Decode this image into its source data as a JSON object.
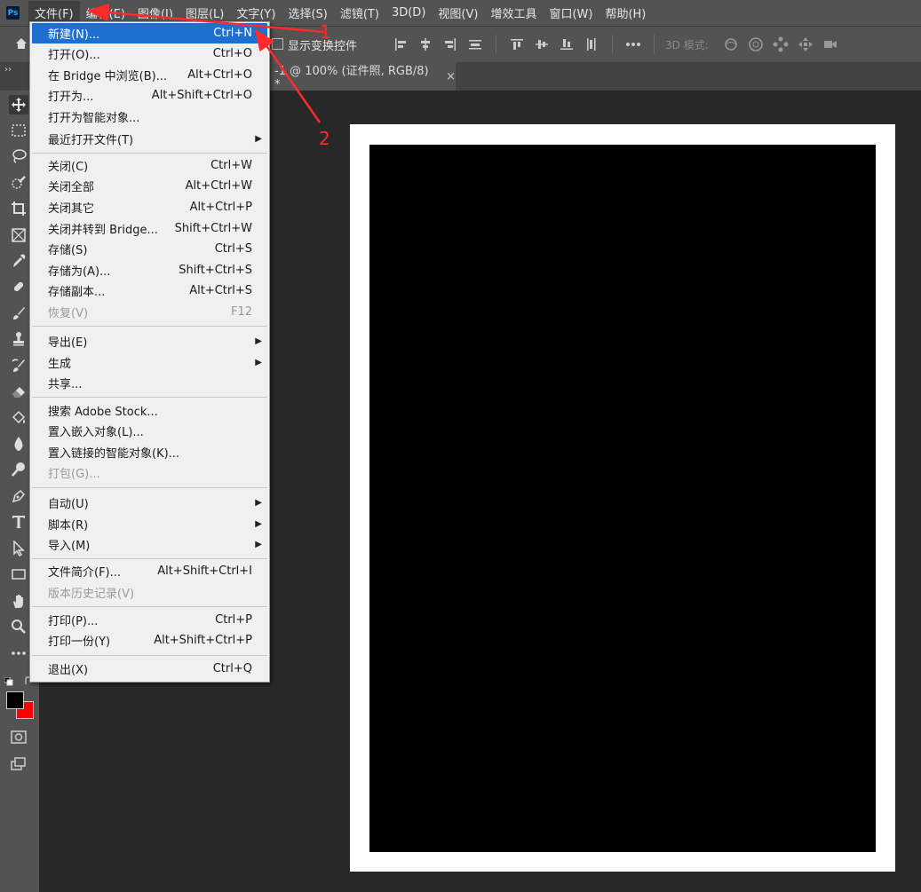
{
  "app": {
    "logo": "Ps"
  },
  "menubar": {
    "items": [
      "文件(F)",
      "编辑(E)",
      "图像(I)",
      "图层(L)",
      "文字(Y)",
      "选择(S)",
      "滤镜(T)",
      "3D(D)",
      "视图(V)",
      "增效工具",
      "窗口(W)",
      "帮助(H)"
    ]
  },
  "options": {
    "show_transform": "显示变换控件",
    "mode_3d": "3D 模式:"
  },
  "document_tab": {
    "title": "-1 @ 100% (证件照, RGB/8) *",
    "close": "×"
  },
  "file_menu": {
    "items": [
      {
        "label": "新建(N)...",
        "shortcut": "Ctrl+N",
        "highlight": true
      },
      {
        "label": "打开(O)...",
        "shortcut": "Ctrl+O"
      },
      {
        "label": "在 Bridge 中浏览(B)...",
        "shortcut": "Alt+Ctrl+O"
      },
      {
        "label": "打开为...",
        "shortcut": "Alt+Shift+Ctrl+O"
      },
      {
        "label": "打开为智能对象...",
        "shortcut": ""
      },
      {
        "label": "最近打开文件(T)",
        "shortcut": "",
        "submenu": true
      },
      {
        "label": "关闭(C)",
        "shortcut": "Ctrl+W"
      },
      {
        "label": "关闭全部",
        "shortcut": "Alt+Ctrl+W"
      },
      {
        "label": "关闭其它",
        "shortcut": "Alt+Ctrl+P"
      },
      {
        "label": "关闭并转到 Bridge...",
        "shortcut": "Shift+Ctrl+W"
      },
      {
        "label": "存储(S)",
        "shortcut": "Ctrl+S"
      },
      {
        "label": "存储为(A)...",
        "shortcut": "Shift+Ctrl+S"
      },
      {
        "label": "存储副本...",
        "shortcut": "Alt+Ctrl+S"
      },
      {
        "label": "恢复(V)",
        "shortcut": "F12",
        "disabled": true
      },
      {
        "label": "导出(E)",
        "shortcut": "",
        "submenu": true
      },
      {
        "label": "生成",
        "shortcut": "",
        "submenu": true
      },
      {
        "label": "共享...",
        "shortcut": ""
      },
      {
        "label": "搜索 Adobe Stock...",
        "shortcut": ""
      },
      {
        "label": "置入嵌入对象(L)...",
        "shortcut": ""
      },
      {
        "label": "置入链接的智能对象(K)...",
        "shortcut": ""
      },
      {
        "label": "打包(G)...",
        "shortcut": "",
        "disabled": true
      },
      {
        "label": "自动(U)",
        "shortcut": "",
        "submenu": true
      },
      {
        "label": "脚本(R)",
        "shortcut": "",
        "submenu": true
      },
      {
        "label": "导入(M)",
        "shortcut": "",
        "submenu": true
      },
      {
        "label": "文件简介(F)...",
        "shortcut": "Alt+Shift+Ctrl+I"
      },
      {
        "label": "版本历史记录(V)",
        "shortcut": "",
        "disabled": true
      },
      {
        "label": "打印(P)...",
        "shortcut": "Ctrl+P"
      },
      {
        "label": "打印一份(Y)",
        "shortcut": "Alt+Shift+Ctrl+P"
      },
      {
        "label": "退出(X)",
        "shortcut": "Ctrl+Q"
      }
    ],
    "submenu_arrow": "▶"
  },
  "annotations": {
    "step1": "1",
    "step2": "2",
    "color": "#ff2a2a"
  },
  "colors": {
    "foreground": "#000000",
    "background": "#ff0000",
    "highlight": "#1e6fd0"
  },
  "tools": [
    "move-icon",
    "marquee-icon",
    "lasso-icon",
    "quick-select-icon",
    "crop-icon",
    "frame-icon",
    "eyedropper-icon",
    "healing-icon",
    "brush-icon",
    "stamp-icon",
    "history-brush-icon",
    "eraser-icon",
    "paint-bucket-icon",
    "blur-icon",
    "dodge-icon",
    "pen-icon",
    "type-icon",
    "path-select-icon",
    "rectangle-icon",
    "hand-icon",
    "zoom-icon",
    "more-icon"
  ]
}
